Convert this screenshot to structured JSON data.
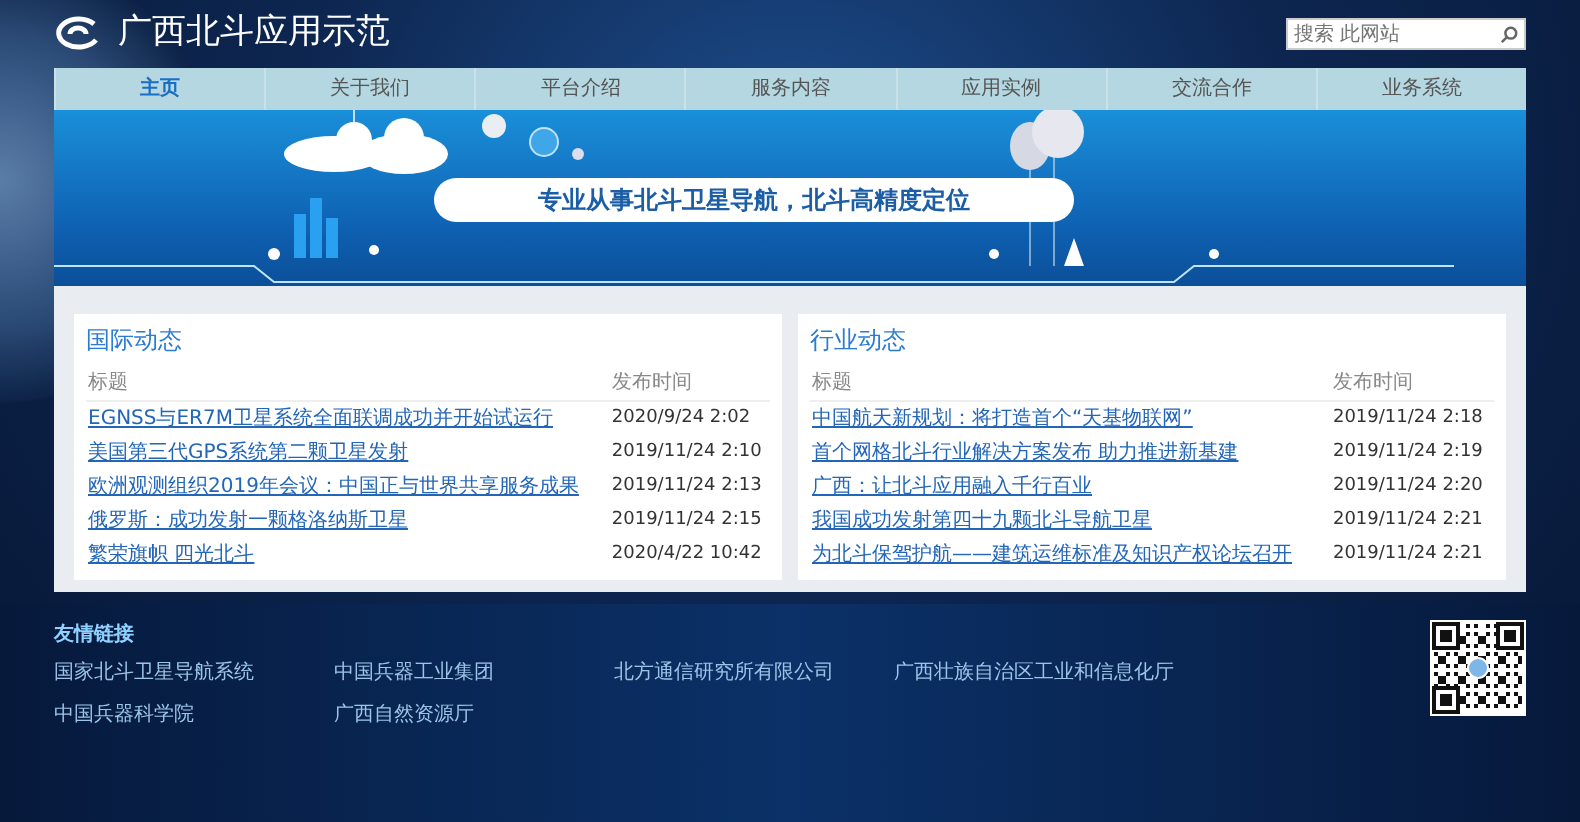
{
  "header": {
    "logo_text": "广西北斗应用示范",
    "search": {
      "placeholder": "搜索 此网站"
    }
  },
  "nav": [
    {
      "label": "主页",
      "selected": true
    },
    {
      "label": "关于我们",
      "selected": false
    },
    {
      "label": "平台介绍",
      "selected": false
    },
    {
      "label": "服务内容",
      "selected": false
    },
    {
      "label": "应用实例",
      "selected": false
    },
    {
      "label": "交流合作",
      "selected": false
    },
    {
      "label": "业务系统",
      "selected": false
    }
  ],
  "banner": {
    "slogan": "专业从事北斗卫星导航，北斗高精度定位"
  },
  "panels": [
    {
      "title": "国际动态",
      "columns": [
        "标题",
        "发布时间"
      ],
      "rows": [
        {
          "title": "EGNSS与ER7M卫星系统全面联调成功并开始试运行",
          "date": "2020/9/24 2:02"
        },
        {
          "title": "美国第三代GPS系统第二颗卫星发射",
          "date": "2019/11/24 2:10"
        },
        {
          "title": "欧洲观测组织2019年会议：中国正与世界共享服务成果",
          "date": "2019/11/24 2:13"
        },
        {
          "title": "俄罗斯：成功发射一颗格洛纳斯卫星",
          "date": "2019/11/24 2:15"
        },
        {
          "title": "繁荣旗帜 四光北斗",
          "date": "2020/4/22 10:42"
        }
      ]
    },
    {
      "title": "行业动态",
      "columns": [
        "标题",
        "发布时间"
      ],
      "rows": [
        {
          "title": "中国航天新规划：将打造首个“天基物联网”",
          "date": "2019/11/24 2:18"
        },
        {
          "title": "首个网格北斗行业解决方案发布 助力推进新基建",
          "date": "2019/11/24 2:19"
        },
        {
          "title": "广西：让北斗应用融入千行百业",
          "date": "2019/11/24 2:20"
        },
        {
          "title": "我国成功发射第四十九颗北斗导航卫星",
          "date": "2019/11/24 2:21"
        },
        {
          "title": "为北斗保驾护航——建筑运维标准及知识产权论坛召开",
          "date": "2019/11/24 2:21"
        }
      ]
    }
  ],
  "footer": {
    "title": "友情链接",
    "links": [
      "国家北斗卫星导航系统",
      "中国兵器工业集团",
      "北方通信研究所有限公司",
      "广西壮族自治区工业和信息化厅",
      "中国兵器科学院",
      "广西自然资源厅"
    ]
  }
}
